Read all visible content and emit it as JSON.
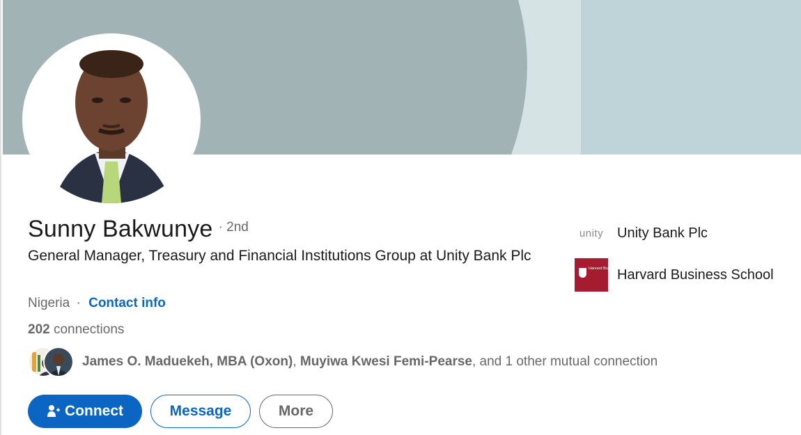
{
  "profile": {
    "name": "Sunny Bakwunye",
    "degree": "· 2nd",
    "headline": "General Manager, Treasury and Financial Institutions Group at Unity Bank Plc",
    "location": "Nigeria",
    "location_separator": "·",
    "contact_info_label": "Contact info",
    "connections_count": "202",
    "connections_label": "connections"
  },
  "mutual": {
    "name1": "James O. Maduekeh, MBA (Oxon)",
    "separator": ",",
    "name2": "Muyiwa Kwesi Femi-Pearse",
    "suffix": ", and 1 other mutual connection"
  },
  "actions": {
    "connect_label": "Connect",
    "message_label": "Message",
    "more_label": "More"
  },
  "side": {
    "items": [
      {
        "label": "Unity Bank Plc",
        "logo_text": "unity"
      },
      {
        "label": "Harvard Business School",
        "logo_text": "Harvard Business School"
      }
    ]
  },
  "colors": {
    "primary": "#0a66c2",
    "banner_dark": "#a2b3b6",
    "banner_light": "#bfd4d8",
    "hbs_red": "#a51c30"
  },
  "icons": {
    "connect": "add-person-icon"
  }
}
